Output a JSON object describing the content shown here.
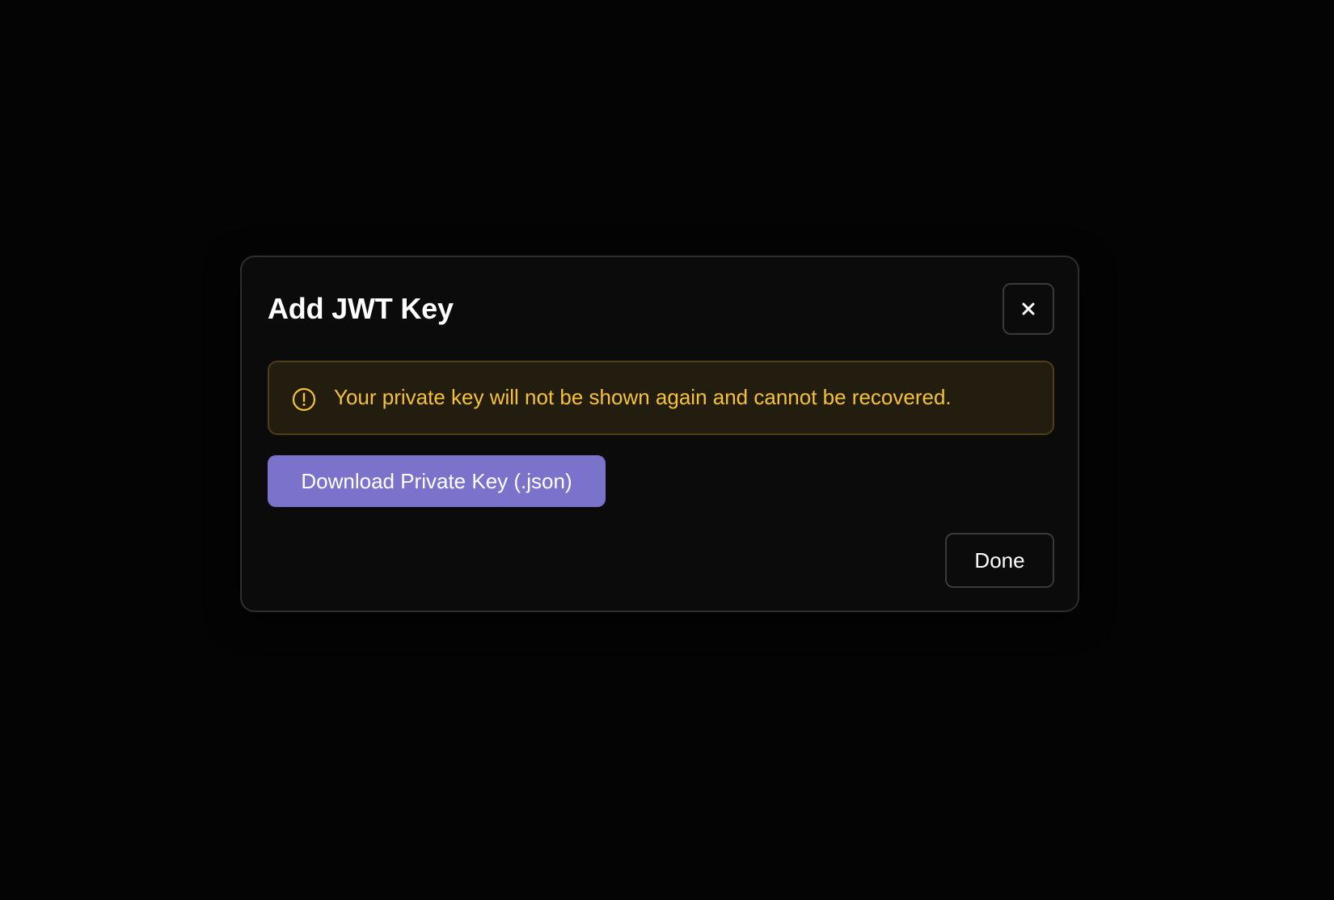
{
  "dialog": {
    "title": "Add JWT Key",
    "close_icon": "close-icon",
    "warning": {
      "icon": "alert-circle-icon",
      "text": "Your private key will not be shown again and cannot be recovered.",
      "color": "#f5c13a",
      "background": "#231d10"
    },
    "download_button_label": "Download Private Key (.json)",
    "download_button_color": "#7b72cc",
    "done_button_label": "Done"
  }
}
